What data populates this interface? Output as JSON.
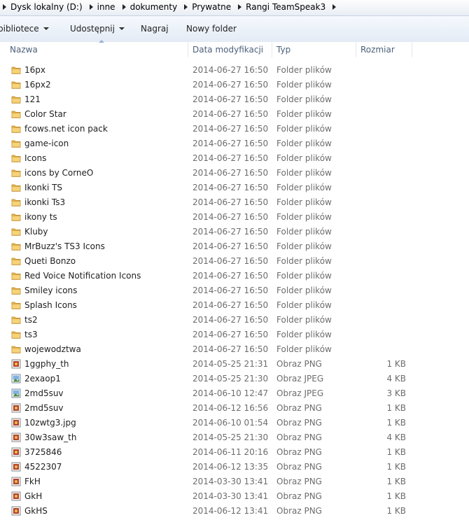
{
  "breadcrumbs": [
    "Dysk lokalny (D:)",
    "inne",
    "dokumenty",
    "Prywatne",
    "Rangi TeamSpeak3"
  ],
  "toolbar": {
    "library": "bibliotece",
    "share": "Udostępnij",
    "burn": "Nagraj",
    "new_folder": "Nowy folder"
  },
  "columns": {
    "name": "Nazwa",
    "date": "Data modyfikacji",
    "type": "Typ",
    "size": "Rozmiar"
  },
  "files": [
    {
      "name": "16px",
      "date": "2014-06-27 16:50",
      "type": "Folder plików",
      "size": "",
      "icon": "folder-icon"
    },
    {
      "name": "16px2",
      "date": "2014-06-27 16:50",
      "type": "Folder plików",
      "size": "",
      "icon": "folder-icon"
    },
    {
      "name": "121",
      "date": "2014-06-27 16:50",
      "type": "Folder plików",
      "size": "",
      "icon": "folder-icon"
    },
    {
      "name": "Color Star",
      "date": "2014-06-27 16:50",
      "type": "Folder plików",
      "size": "",
      "icon": "folder-icon"
    },
    {
      "name": "fcows.net icon pack",
      "date": "2014-06-27 16:50",
      "type": "Folder plików",
      "size": "",
      "icon": "folder-icon"
    },
    {
      "name": "game-icon",
      "date": "2014-06-27 16:50",
      "type": "Folder plików",
      "size": "",
      "icon": "folder-icon"
    },
    {
      "name": "Icons",
      "date": "2014-06-27 16:50",
      "type": "Folder plików",
      "size": "",
      "icon": "folder-icon"
    },
    {
      "name": "icons by CorneO",
      "date": "2014-06-27 16:50",
      "type": "Folder plików",
      "size": "",
      "icon": "folder-icon"
    },
    {
      "name": "Ikonki TS",
      "date": "2014-06-27 16:50",
      "type": "Folder plików",
      "size": "",
      "icon": "folder-icon"
    },
    {
      "name": "ikonki Ts3",
      "date": "2014-06-27 16:50",
      "type": "Folder plików",
      "size": "",
      "icon": "folder-icon"
    },
    {
      "name": "ikony ts",
      "date": "2014-06-27 16:50",
      "type": "Folder plików",
      "size": "",
      "icon": "folder-icon"
    },
    {
      "name": "Kluby",
      "date": "2014-06-27 16:50",
      "type": "Folder plików",
      "size": "",
      "icon": "folder-icon"
    },
    {
      "name": "MrBuzz's TS3 Icons",
      "date": "2014-06-27 16:50",
      "type": "Folder plików",
      "size": "",
      "icon": "folder-icon"
    },
    {
      "name": "Queti Bonzo",
      "date": "2014-06-27 16:50",
      "type": "Folder plików",
      "size": "",
      "icon": "folder-icon"
    },
    {
      "name": "Red Voice Notification Icons",
      "date": "2014-06-27 16:50",
      "type": "Folder plików",
      "size": "",
      "icon": "folder-icon"
    },
    {
      "name": "Smiley icons",
      "date": "2014-06-27 16:50",
      "type": "Folder plików",
      "size": "",
      "icon": "folder-icon"
    },
    {
      "name": "Splash Icons",
      "date": "2014-06-27 16:50",
      "type": "Folder plików",
      "size": "",
      "icon": "folder-icon"
    },
    {
      "name": "ts2",
      "date": "2014-06-27 16:50",
      "type": "Folder plików",
      "size": "",
      "icon": "folder-icon"
    },
    {
      "name": "ts3",
      "date": "2014-06-27 16:50",
      "type": "Folder plików",
      "size": "",
      "icon": "folder-icon"
    },
    {
      "name": "wojewodztwa",
      "date": "2014-06-27 16:50",
      "type": "Folder plików",
      "size": "",
      "icon": "folder-icon"
    },
    {
      "name": "1ggphy_th",
      "date": "2014-05-25 21:31",
      "type": "Obraz PNG",
      "size": "1 KB",
      "icon": "png-image-icon"
    },
    {
      "name": "2exaop1",
      "date": "2014-05-25 21:30",
      "type": "Obraz JPEG",
      "size": "4 KB",
      "icon": "jpeg-image-icon"
    },
    {
      "name": "2md5suv",
      "date": "2014-06-10 12:47",
      "type": "Obraz JPEG",
      "size": "3 KB",
      "icon": "jpeg-image-icon"
    },
    {
      "name": "2md5suv",
      "date": "2014-06-12 16:56",
      "type": "Obraz PNG",
      "size": "1 KB",
      "icon": "png-image-icon"
    },
    {
      "name": "10zwtg3.jpg",
      "date": "2014-06-10 01:54",
      "type": "Obraz PNG",
      "size": "1 KB",
      "icon": "png-image-icon"
    },
    {
      "name": "30w3saw_th",
      "date": "2014-05-25 21:30",
      "type": "Obraz PNG",
      "size": "4 KB",
      "icon": "png-image-icon"
    },
    {
      "name": "3725846",
      "date": "2014-06-11 20:16",
      "type": "Obraz PNG",
      "size": "1 KB",
      "icon": "png-image-icon"
    },
    {
      "name": "4522307",
      "date": "2014-06-12 13:35",
      "type": "Obraz PNG",
      "size": "1 KB",
      "icon": "png-image-icon"
    },
    {
      "name": "FkH",
      "date": "2014-03-30 13:41",
      "type": "Obraz PNG",
      "size": "1 KB",
      "icon": "png-image-icon"
    },
    {
      "name": "GkH",
      "date": "2014-03-30 13:41",
      "type": "Obraz PNG",
      "size": "1 KB",
      "icon": "png-image-icon"
    },
    {
      "name": "GkHS",
      "date": "2014-06-12 13:41",
      "type": "Obraz PNG",
      "size": "1 KB",
      "icon": "png-image-icon"
    }
  ]
}
